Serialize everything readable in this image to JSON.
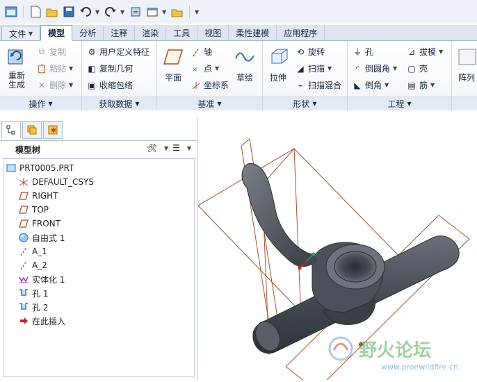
{
  "quick_access": {
    "icons": [
      "window-icon",
      "new-icon",
      "open-icon",
      "save-icon",
      "undo-icon",
      "redo-icon",
      "regenerate-icon",
      "windows-icon",
      "close-window-icon",
      "customize-icon"
    ]
  },
  "tabs": [
    {
      "label": "文件",
      "kind": "file"
    },
    {
      "label": "模型",
      "kind": "active"
    },
    {
      "label": "分析"
    },
    {
      "label": "注释"
    },
    {
      "label": "渲染"
    },
    {
      "label": "工具"
    },
    {
      "label": "视图"
    },
    {
      "label": "柔性建模"
    },
    {
      "label": "应用程序"
    }
  ],
  "ribbon": {
    "operations": {
      "label": "操作",
      "regenerate": "重新生成",
      "copy": "复制",
      "paste": "粘贴",
      "delete": "删除"
    },
    "get_data": {
      "label": "获取数据",
      "user_feature": "用户定义特征",
      "copy_geometry": "复制几何",
      "shrinkwrap": "收缩包络"
    },
    "datum": {
      "label": "基准",
      "plane": "平面",
      "axis": "轴",
      "point": "点",
      "csys": "坐标系",
      "sketch": "草绘"
    },
    "shapes": {
      "label": "形状",
      "extrude": "拉伸",
      "revolve": "旋转",
      "sweep": "扫描",
      "swept_blend": "扫描混合"
    },
    "engineering": {
      "label": "工程",
      "hole": "孔",
      "round": "倒圆角",
      "chamfer": "倒角",
      "draft": "拔模",
      "shell": "壳",
      "rib": "筋"
    },
    "pattern": {
      "label": "阵列"
    }
  },
  "model_tree": {
    "title": "模型树",
    "items": [
      {
        "label": "PRT0005.PRT",
        "icon": "part-icon"
      },
      {
        "label": "DEFAULT_CSYS",
        "icon": "csys-icon"
      },
      {
        "label": "RIGHT",
        "icon": "datum-plane-icon"
      },
      {
        "label": "TOP",
        "icon": "datum-plane-icon"
      },
      {
        "label": "FRONT",
        "icon": "datum-plane-icon"
      },
      {
        "label": "自由式 1",
        "icon": "freestyle-icon"
      },
      {
        "label": "A_1",
        "icon": "axis-icon"
      },
      {
        "label": "A_2",
        "icon": "axis-icon"
      },
      {
        "label": "实体化 1",
        "icon": "solidify-icon"
      },
      {
        "label": "孔 1",
        "icon": "hole-icon"
      },
      {
        "label": "孔 2",
        "icon": "hole-icon"
      },
      {
        "label": "在此插入",
        "icon": "insert-here-icon"
      }
    ]
  },
  "watermark": {
    "text": "野火论坛",
    "url": "www.proewildfire.cn"
  },
  "colors": {
    "ribbon_accent": "#2b4f86",
    "model_body": "#4a4f57",
    "datum_frame": "#a0522d"
  }
}
